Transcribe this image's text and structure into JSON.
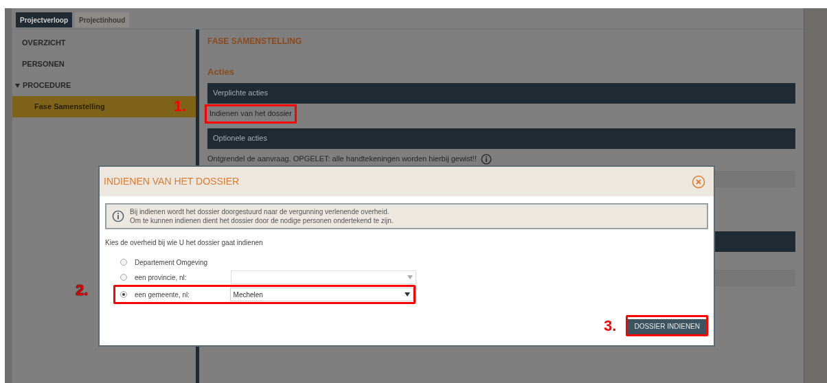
{
  "tabs": [
    {
      "label": "Projectverloop",
      "selected": true
    },
    {
      "label": "Projectinhoud",
      "selected": false
    }
  ],
  "sidebar": {
    "items": [
      {
        "label": "OVERZICHT",
        "selected": false
      },
      {
        "label": "PERSONEN",
        "selected": false
      },
      {
        "label": "PROCEDURE",
        "selected": false,
        "expanded": true,
        "children": [
          {
            "label": "Fase Samenstelling",
            "selected": true,
            "annotation": "1."
          }
        ]
      }
    ]
  },
  "content": {
    "title": "FASE SAMENSTELLING",
    "section": "Acties",
    "groups": [
      {
        "header": "Verplichte acties",
        "items": [
          {
            "label": "Indienen van het dossier",
            "highlighted": true
          }
        ]
      },
      {
        "header": "Optionele acties",
        "items": [
          {
            "label": "Ontgrendel de aanvraag. OPGELET: alle handtekeningen worden hierbij gewist!!",
            "info": true
          }
        ]
      }
    ]
  },
  "dialog": {
    "title": "INDIENEN VAN HET DOSSIER",
    "info": [
      "Bij indienen wordt het dossier doorgestuurd naar de vergunning verlenende overheid.",
      "Om te kunnen indienen dient het dossier door de nodige personen ondertekend te zijn."
    ],
    "prompt": "Kies de overheid bij wie U het dossier gaat indienen",
    "options": [
      {
        "kind": "plain",
        "label": "Departement Omgeving",
        "selected": false
      },
      {
        "kind": "select",
        "label": "een provincie, nl:",
        "selected": false
      },
      {
        "kind": "select",
        "label": "een gemeente, nl:",
        "selected": true,
        "value": "Mechelen",
        "annotation": "2."
      }
    ],
    "button": {
      "label": "DOSSIER INDIENEN",
      "annotation": "3."
    }
  }
}
